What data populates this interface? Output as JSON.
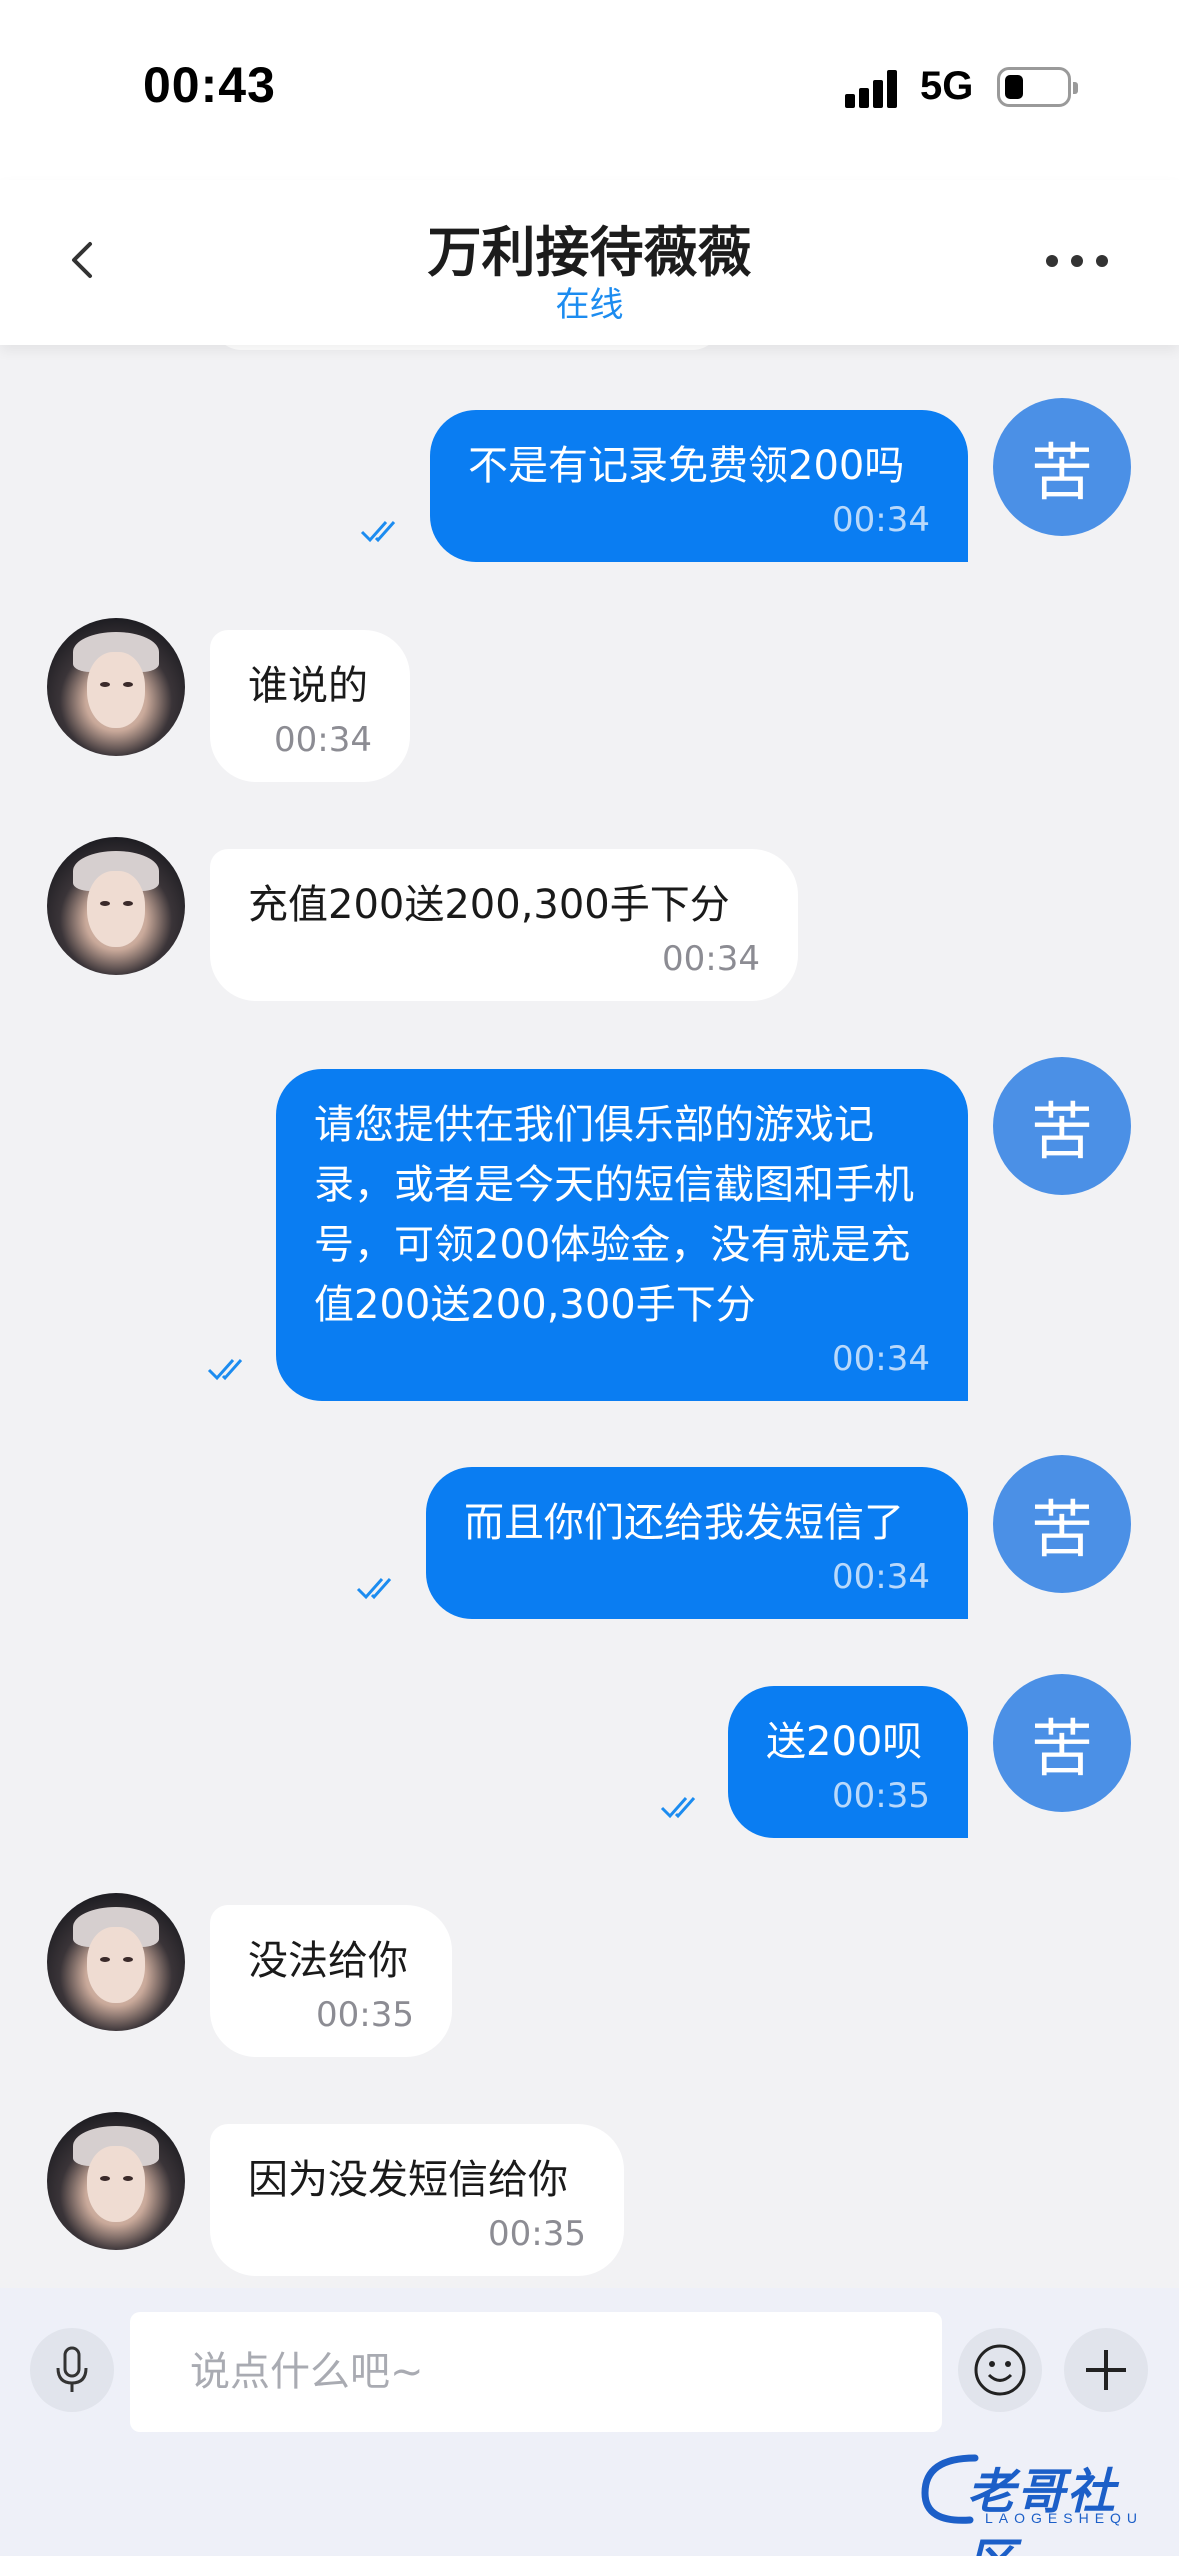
{
  "status_bar": {
    "time": "00:43",
    "network": "5G"
  },
  "header": {
    "title": "万利接待薇薇",
    "status": "在线"
  },
  "colors": {
    "accent": "#0a7df2",
    "avatar_me": "#4b90e6",
    "online": "#1c8cf0"
  },
  "me": {
    "avatar_text": "苦"
  },
  "messages": [
    {
      "from": "me",
      "text": "不是有记录免费领200吗",
      "time": "00:34",
      "read": true
    },
    {
      "from": "them",
      "text": "谁说的",
      "time": "00:34"
    },
    {
      "from": "them",
      "text": "充值200送200,300手下分",
      "time": "00:34"
    },
    {
      "from": "me",
      "text": "请您提供在我们俱乐部的游戏记录，或者是今天的短信截图和手机号，可领200体验金，没有就是充值200送200,300手下分",
      "time": "00:34",
      "read": true
    },
    {
      "from": "me",
      "text": "而且你们还给我发短信了",
      "time": "00:34",
      "read": true
    },
    {
      "from": "me",
      "text": "送200呗",
      "time": "00:35",
      "read": true
    },
    {
      "from": "them",
      "text": "没法给你",
      "time": "00:35"
    },
    {
      "from": "them",
      "text": "因为没发短信给你",
      "time": "00:35"
    }
  ],
  "input": {
    "placeholder": "说点什么吧~"
  },
  "icons": {
    "back": "chevron-left-icon",
    "more": "more-dots-icon",
    "mic": "mic-icon",
    "emoji": "emoji-icon",
    "add": "plus-icon",
    "read": "double-check-icon"
  },
  "watermark": {
    "text": "老哥社区",
    "sub": "LAOGESHEQU"
  }
}
